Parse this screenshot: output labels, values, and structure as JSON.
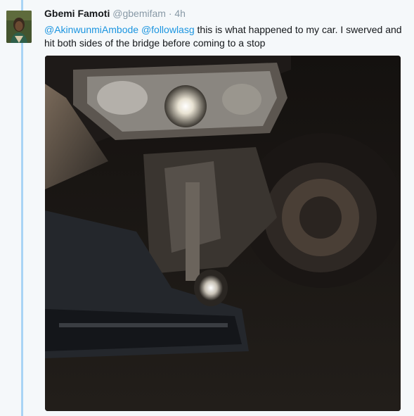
{
  "tweet": {
    "author_name": "Gbemi Famoti",
    "handle": "@gbemifam",
    "separator": "·",
    "timestamp": "4h",
    "mentions": [
      "@AkinwunmiAmbode",
      "@followlasg"
    ],
    "text": "this is what happened to my car. I swerved and hit both sides of the bridge before coming to a stop"
  },
  "colors": {
    "thread_line": "#a9d4f5",
    "mention": "#1b95e0",
    "meta": "#8899a6",
    "text": "#14171a"
  }
}
